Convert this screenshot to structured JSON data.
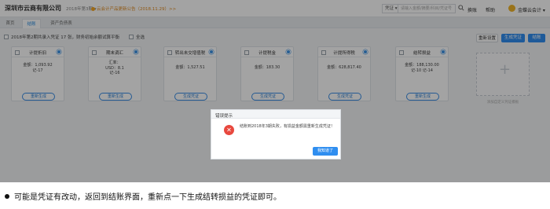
{
  "header": {
    "company": "深圳市云商有限公司",
    "period": "2018年第3期 ▾",
    "notice": "云会计产品更新公告（2018.11.29）>>",
    "search_type": "凭证 ▾",
    "search_placeholder": "请输入金额/摘要/科目/凭证号",
    "links": {
      "switch": "换账",
      "help": "帮助"
    },
    "user": "金蝶云会计 ▾"
  },
  "tabs": [
    {
      "label": "首页"
    },
    {
      "label": "结账"
    },
    {
      "label": "资产负债表"
    }
  ],
  "toolbar": {
    "status": "2018年第2期共录入凭证 17 张，财务初始余额试算平衡",
    "select_all": "全选",
    "reset_btn": "重新设置",
    "generate_btn": "生成凭证",
    "close_btn": "结账"
  },
  "cards": [
    {
      "title": "计提折旧",
      "line1": "金额：1,093.92",
      "line2": "记-17",
      "line3": "",
      "action": "重新生成"
    },
    {
      "title": "期末调汇",
      "line1": "汇率：",
      "line2": "USD：8.1",
      "line3": "记-16",
      "action": "重新生成"
    },
    {
      "title": "转出未交增值税",
      "line1": "金额：1,527.51",
      "line2": "",
      "line3": "",
      "action": "生成凭证"
    },
    {
      "title": "计提税金",
      "line1": "金额：183.30",
      "line2": "",
      "line3": "",
      "action": "生成凭证"
    },
    {
      "title": "计提所得税",
      "line1": "金额：628,817.40",
      "line2": "",
      "line3": "",
      "action": "生成凭证"
    },
    {
      "title": "结转损益",
      "line1": "金额：188,130.00",
      "line2": "记-10 记-14",
      "line3": "",
      "action": "重新生成"
    }
  ],
  "add_card": {
    "label": "添加自定义凭证模板"
  },
  "dialog": {
    "title": "错误提示",
    "message": "结账到2018年3期失败，有损益金额需重新生成凭证！",
    "confirm": "我知道了"
  },
  "caption": "可能是凭证有改动，返回到结账界面，重新点一下生成结转损益的凭证即可。",
  "colors": {
    "primary": "#2f8ef0",
    "error": "#e8483e",
    "notice": "#e08a1e"
  }
}
